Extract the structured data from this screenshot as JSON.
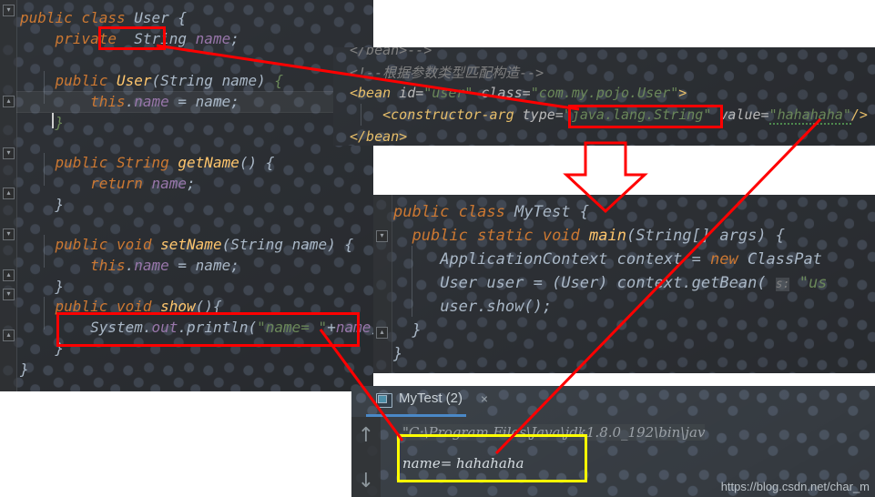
{
  "window": {
    "watermark": "https://blog.csdn.net/char_m"
  },
  "left_editor": {
    "name": "User.java",
    "lines": [
      {
        "id": "l1",
        "text": "public class User {"
      },
      {
        "id": "l2",
        "text": "    private  String name;"
      },
      {
        "id": "l3",
        "text": ""
      },
      {
        "id": "l4",
        "text": "    public User(String name) {"
      },
      {
        "id": "l5",
        "text": "        this.name = name;"
      },
      {
        "id": "l6",
        "text": "    }"
      },
      {
        "id": "l7",
        "text": ""
      },
      {
        "id": "l8",
        "text": "    public String getName() {"
      },
      {
        "id": "l9",
        "text": "        return name;"
      },
      {
        "id": "l10",
        "text": "    }"
      },
      {
        "id": "l11",
        "text": ""
      },
      {
        "id": "l12",
        "text": "    public void setName(String name) {"
      },
      {
        "id": "l13",
        "text": "        this.name = name;"
      },
      {
        "id": "l14",
        "text": "    }"
      },
      {
        "id": "l15",
        "text": "    public void show(){"
      },
      {
        "id": "l16",
        "text": "        System.out.println(\"name= \"+name);"
      },
      {
        "id": "l17",
        "text": "    }"
      },
      {
        "id": "l18",
        "text": "}"
      }
    ]
  },
  "xml_editor": {
    "name": "applicationContext.xml",
    "lines": [
      {
        "id": "x1",
        "text": "</bean>-->"
      },
      {
        "id": "x2",
        "text": "<!--根据参数类型匹配构造-->"
      },
      {
        "id": "x3",
        "text": "<bean id=\"user\" class=\"com.my.pojo.User\">"
      },
      {
        "id": "x4",
        "text": "    <constructor-arg type=\"java.lang.String\" value=\"hahahaha\"/>"
      },
      {
        "id": "x5",
        "text": "</bean>"
      }
    ],
    "highlighted_token": "\"java.lang.String\"",
    "value_token": "\"hahahaha\""
  },
  "test_editor": {
    "name": "MyTest.java",
    "lines": [
      {
        "id": "t1",
        "text": "public class MyTest {"
      },
      {
        "id": "t2",
        "text": "    public static void main(String[] args) {"
      },
      {
        "id": "t3",
        "text": "        ApplicationContext context = new ClassPat"
      },
      {
        "id": "t4",
        "text": "        User user = (User) context.getBean( s: \"us"
      },
      {
        "id": "t5",
        "text": "        user.show();"
      },
      {
        "id": "t6",
        "text": "    }"
      },
      {
        "id": "t7",
        "text": "}"
      }
    ],
    "hint_label": "s:"
  },
  "console": {
    "tab_label": "MyTest (2)",
    "close_label": "×",
    "scroll_up": "↑",
    "scroll_down": "↓",
    "lines": [
      {
        "id": "c1",
        "text": "\"C:\\Program Files\\Java\\jdk1.8.0_192\\bin\\jav",
        "kind": "path"
      },
      {
        "id": "c2",
        "text": "name= hahahaha",
        "kind": "out"
      }
    ]
  },
  "annotations": {
    "colors": {
      "red": "#ff0000",
      "yellow": "#ffff00"
    },
    "boxes": [
      {
        "id": "b-string-field",
        "label": "String field type highlight",
        "color": "#ff0000"
      },
      {
        "id": "b-xml-type",
        "label": "constructor-arg type highlight",
        "color": "#ff0000"
      },
      {
        "id": "b-println",
        "label": "System.out.println highlight",
        "color": "#ff0000"
      },
      {
        "id": "b-output",
        "label": "console output highlight",
        "color": "#ffff00"
      }
    ],
    "arrows": [
      {
        "id": "a-field-to-type",
        "label": "field type to constructor-arg type"
      },
      {
        "id": "a-down",
        "label": "xml bean flows to MyTest main"
      },
      {
        "id": "a-value-to-output",
        "label": "hahahaha value to console output"
      },
      {
        "id": "a-println-to-output",
        "label": "println statement to console output"
      }
    ]
  }
}
